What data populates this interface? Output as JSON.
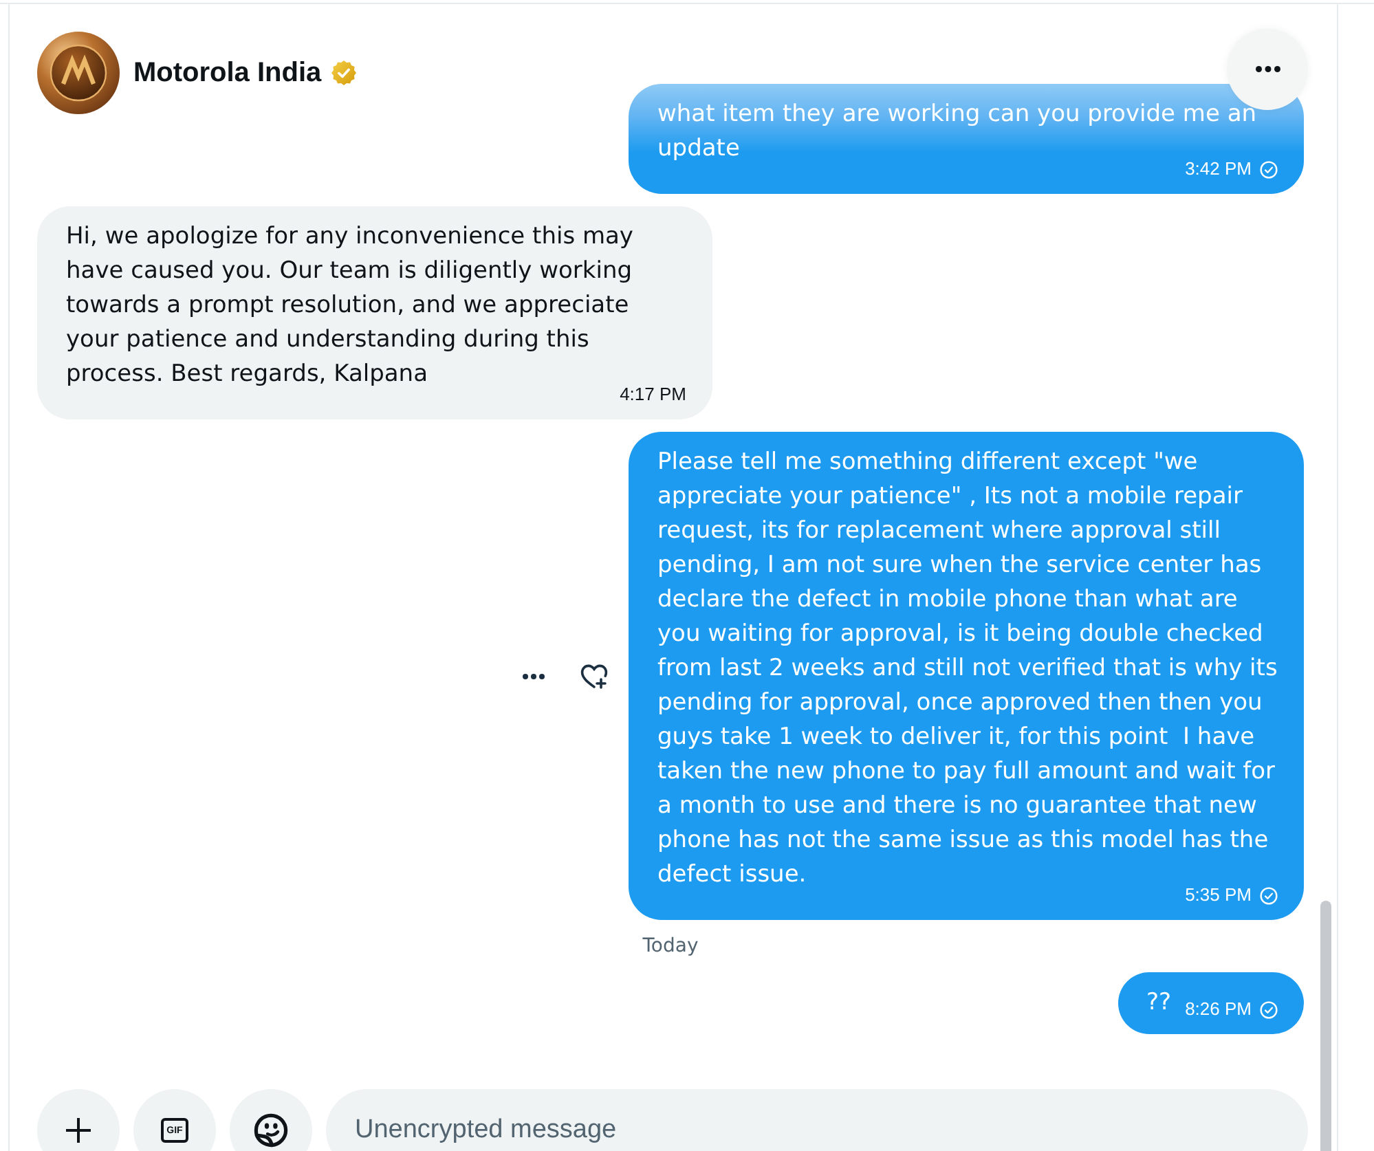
{
  "conversation": {
    "name": "Motorola India",
    "verified": true
  },
  "messages": [
    {
      "kind": "sent",
      "faded": true,
      "text": "what item they are working can you provide me an update",
      "time": "3:42 PM"
    },
    {
      "kind": "received",
      "text": "Hi, we apologize for any inconvenience this may have caused you. Our team is diligently working towards a prompt resolution, and we appreciate your patience and understanding during this process. Best regards, Kalpana",
      "time": "4:17 PM"
    },
    {
      "kind": "sent",
      "hovered": true,
      "text": "Please tell me something different except \"we appreciate your patience\" , Its not a mobile repair request, its for replacement where approval still pending, I am not sure when the service center has declare the defect in mobile phone than what are you waiting for approval, is it being double checked from last 2 weeks and still not verified that is why its pending for approval, once approved then then you guys take 1 week to deliver it, for this point  I have taken the new phone to pay full amount and wait for a month to use and there is no guarantee that new phone has not the same issue as this model has the defect issue.",
      "time": "5:35 PM"
    },
    {
      "kind": "date",
      "label": "Today"
    },
    {
      "kind": "sent",
      "text": "??",
      "time": "8:26 PM"
    }
  ],
  "composer": {
    "buttons": [
      {
        "kind": "add"
      },
      {
        "kind": "gif",
        "label": "GIF"
      },
      {
        "kind": "emoji"
      }
    ],
    "placeholder": "Unencrypted message"
  }
}
